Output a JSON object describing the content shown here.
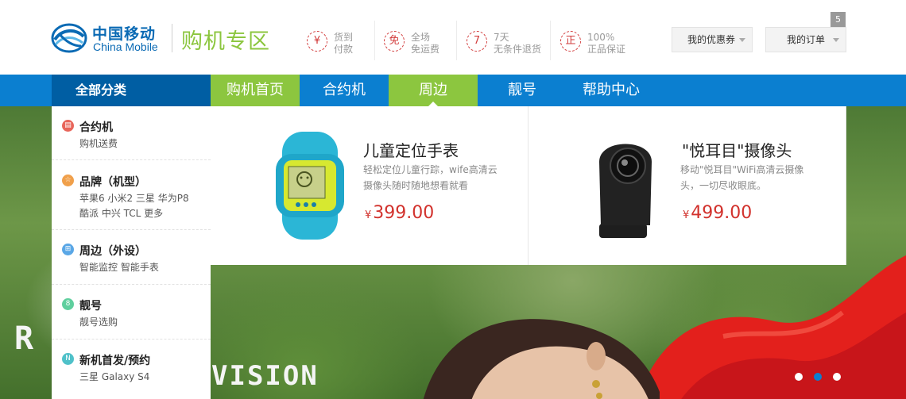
{
  "header": {
    "logo_cn": "中国移动",
    "logo_en": "China Mobile",
    "zone_title": "购机专区",
    "promos": [
      {
        "icon": "¥",
        "line1": "货到",
        "line2": "付款"
      },
      {
        "icon": "免",
        "line1": "全场",
        "line2": "免运费"
      },
      {
        "icon": "7",
        "line1": "7天",
        "line2": "无条件退货"
      },
      {
        "icon": "正",
        "line1": "100%",
        "line2": "正品保证"
      }
    ],
    "coupon_button": "我的优惠券",
    "orders_button": "我的订单",
    "orders_badge": "5"
  },
  "nav": {
    "all_categories": "全部分类",
    "items": [
      "购机首页",
      "合约机",
      "周边",
      "靓号",
      "帮助中心"
    ]
  },
  "sidebar": {
    "categories": [
      {
        "icon": "▤",
        "title": "合约机",
        "sub1": "购机送费",
        "sub2": "",
        "color": "#e8655a"
      },
      {
        "icon": "☆",
        "title": "品牌（机型）",
        "sub1": "苹果6 小米2 三星 华为P8",
        "sub2": "酷派 中兴 TCL 更多",
        "color": "#f0a04b"
      },
      {
        "icon": "⊞",
        "title": "周边（外设）",
        "sub1": "智能监控 智能手表",
        "sub2": "",
        "color": "#5aa7e6"
      },
      {
        "icon": "8",
        "title": "靓号",
        "sub1": "靓号选购",
        "sub2": "",
        "color": "#5fcf9e"
      },
      {
        "icon": "N",
        "title": "新机首发/预约",
        "sub1": "三星 Galaxy S4",
        "sub2": "",
        "color": "#4fc1c9"
      }
    ]
  },
  "products": [
    {
      "name": "儿童定位手表",
      "desc": "轻松定位儿童行踪，wife高清云摄像头随时随地想看就看",
      "currency": "¥",
      "price": "399.00",
      "image": "kids-watch"
    },
    {
      "name": "\"悦耳目\"摄像头",
      "desc": "移动\"悦耳目\"WiFi高清云摄像头，一切尽收眼底。",
      "currency": "¥",
      "price": "499.00",
      "image": "camera"
    }
  ],
  "hero": {
    "overlay_text_1": "R",
    "overlay_text_2": "VISION",
    "slides": 3,
    "active_slide": 2
  },
  "colors": {
    "brand_blue": "#0b7fd0",
    "nav_dark": "#005ea3",
    "brand_green": "#8cc63f",
    "price_red": "#d2322d"
  }
}
